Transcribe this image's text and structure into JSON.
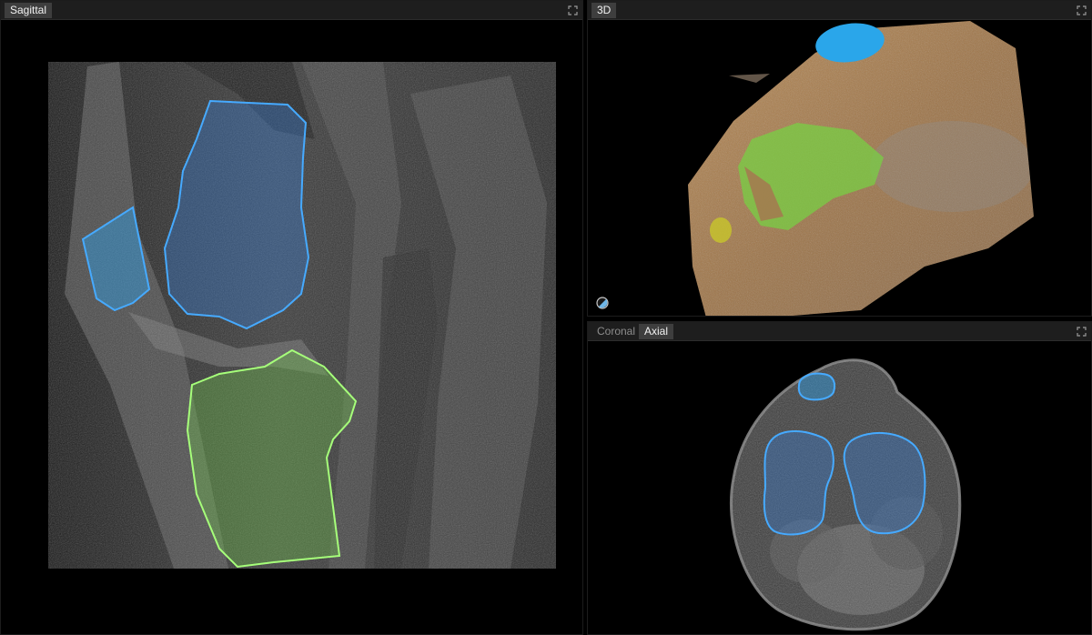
{
  "sagittal_panel": {
    "tab_label": "Sagittal",
    "maximize_icon": "maximize-icon"
  },
  "threed_panel": {
    "tab_label": "3D",
    "maximize_icon": "maximize-icon",
    "render_mode_icon": "half-circle-icon"
  },
  "bottom_panel": {
    "tabs": [
      {
        "label": "Coronal",
        "active": false
      },
      {
        "label": "Axial",
        "active": true
      }
    ],
    "maximize_icon": "maximize-icon"
  },
  "segment_colors": {
    "femur": "#3a8fe6",
    "patella": "#2f9fe8",
    "tibia": "#7ede4a",
    "outline_blue": "#46aaff",
    "outline_green": "#a6ff7a",
    "skin_3d": "#a97c48"
  }
}
